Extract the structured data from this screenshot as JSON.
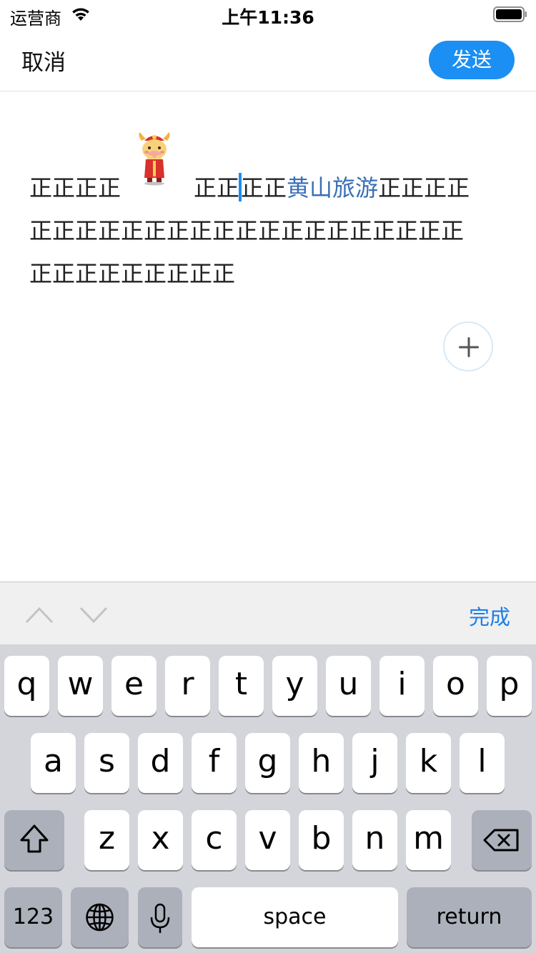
{
  "status_bar": {
    "carrier": "运营商",
    "time": "上午11:36"
  },
  "nav": {
    "cancel_label": "取消",
    "send_label": "发送",
    "send_color": "#1b8ff3"
  },
  "editor": {
    "line1_part1": "正正正正",
    "line1_part2": "正正",
    "line1_part3": "正正",
    "line1_highlight": "黄山旅游",
    "line1_part4": "正正正正",
    "line2": "正正正正正正正正正正正正正正正正正正正",
    "line3": "正正正正正正正正正",
    "highlight_color": "#3a6fb6",
    "sticker": "ox-cartoon-sticker"
  },
  "accessory": {
    "done_label": "完成",
    "done_color": "#1b7fe6"
  },
  "keyboard": {
    "row1": [
      "q",
      "w",
      "e",
      "r",
      "t",
      "y",
      "u",
      "i",
      "o",
      "p"
    ],
    "row2": [
      "a",
      "s",
      "d",
      "f",
      "g",
      "h",
      "j",
      "k",
      "l"
    ],
    "row3": [
      "z",
      "x",
      "c",
      "v",
      "b",
      "n",
      "m"
    ],
    "numbers_label": "123",
    "space_label": "space",
    "return_label": "return"
  }
}
